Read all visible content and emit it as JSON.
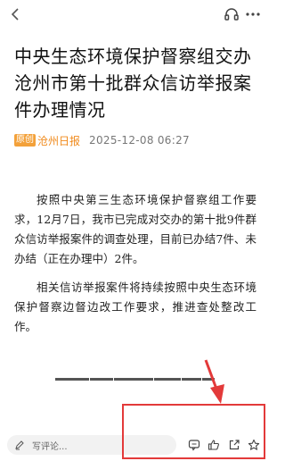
{
  "top_bar": {
    "back_icon": "chevron-left-icon",
    "listen_icon": "headphones-icon",
    "more_icon": "more-horizontal-icon"
  },
  "article": {
    "title": "中央生态环境保护督察组交办沧州市第十批群众信访举报案件办理情况",
    "source_badge": "原创",
    "source_name": "沧州日报",
    "date": "2025-12-08  06:27",
    "paragraphs": [
      "按照中央第三生态环境保护督察组工作要求，12月7日，我市已完成对交办的第十批9件群众信访举报案件的调查处理，目前已办结7件、未办结（正在办理中）2件。",
      "相关信访举报案件将持续按照中央生态环境保护督察边督边改工作要求，推进查处整改工作。"
    ]
  },
  "bottom_bar": {
    "comment_placeholder": "写评论...",
    "icons": [
      "comment-icon",
      "thumbs-up-icon",
      "share-icon",
      "star-icon"
    ]
  },
  "colors": {
    "accent": "#f3a13a",
    "source": "#f08a1c",
    "annotation": "#e33a3a"
  }
}
